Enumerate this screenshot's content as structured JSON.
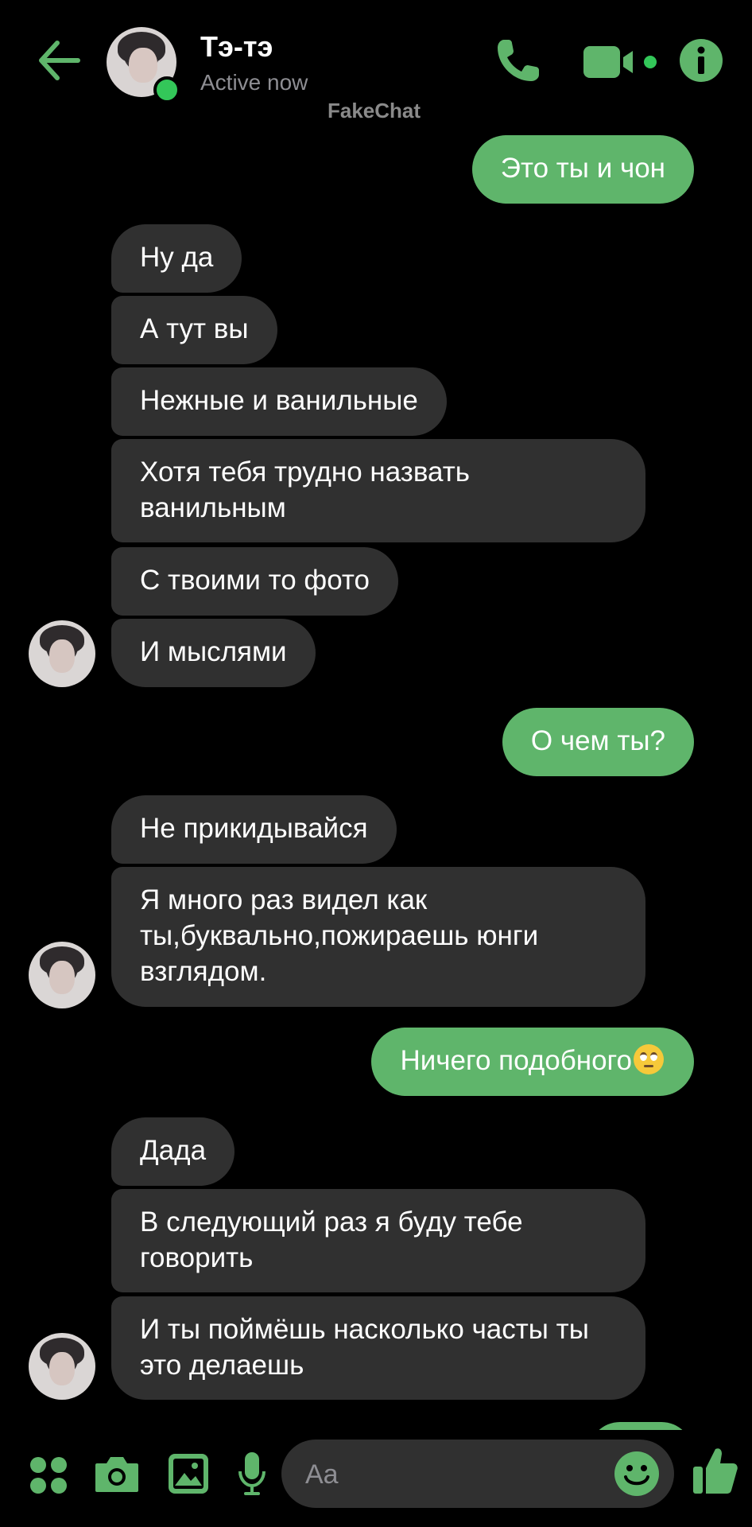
{
  "header": {
    "contact_name": "Тэ-тэ",
    "status": "Active now",
    "watermark": "FakeChat"
  },
  "colors": {
    "accent": "#5fb56b",
    "incoming_bubble": "#303030",
    "online": "#33c759",
    "background": "#000000"
  },
  "icons": [
    "back-arrow-icon",
    "phone-icon",
    "video-camera-icon",
    "info-icon",
    "apps-icon",
    "camera-icon",
    "gallery-icon",
    "microphone-icon",
    "emoji-icon",
    "thumbs-up-icon"
  ],
  "messages": [
    {
      "side": "out",
      "text": "Это ты и чон"
    },
    {
      "side": "in",
      "text": "Ну да"
    },
    {
      "side": "in",
      "text": "А тут вы"
    },
    {
      "side": "in",
      "text": "Нежные и ванильные"
    },
    {
      "side": "in",
      "text": "Хотя тебя трудно назвать ванильным"
    },
    {
      "side": "in",
      "text": "С твоими то фото"
    },
    {
      "side": "in",
      "text": "И мыслями"
    },
    {
      "side": "out",
      "text": "О чем ты?"
    },
    {
      "side": "in",
      "text": "Не прикидывайся"
    },
    {
      "side": "in",
      "text": "Я много раз видел как ты,буквально,пожираешь юнги взглядом."
    },
    {
      "side": "out",
      "text": "Ничего подобного",
      "emoji": "face-with-rolling-eyes"
    },
    {
      "side": "in",
      "text": "Дада"
    },
    {
      "side": "in",
      "text": "В следующий раз я буду тебе говорить"
    },
    {
      "side": "in",
      "text": "И ты поймёшь насколько часты ты это делаешь"
    }
  ],
  "composer": {
    "placeholder": "Aa"
  }
}
